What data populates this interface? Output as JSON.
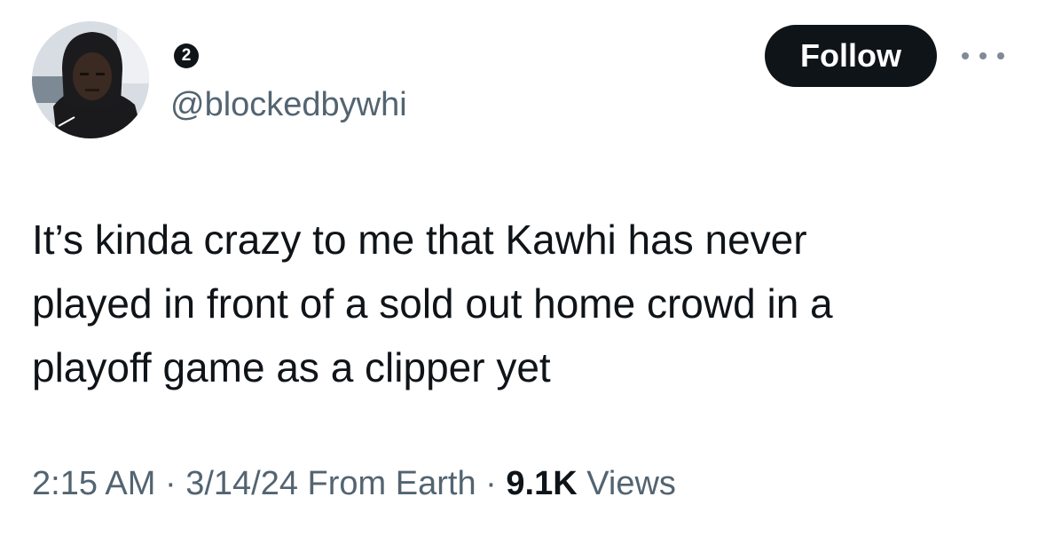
{
  "author": {
    "badge_count": "2",
    "handle": "@blockedbywhi",
    "avatar_icon": "profile-photo-person-in-hood"
  },
  "actions": {
    "follow_label": "Follow",
    "more_icon": "more-horizontal-icon"
  },
  "tweet": {
    "text": "It’s kinda crazy to me that Kawhi has never\nplayed in front of a sold out home crowd in a\nplayoff game as a clipper yet"
  },
  "meta": {
    "time": "2:15 AM",
    "sep1": " · ",
    "date": "3/14/24",
    "location": " From Earth",
    "sep2": " · ",
    "views_count": "9.1K",
    "views_label": " Views"
  },
  "colors": {
    "text_primary": "#0f1419",
    "text_secondary": "#536471",
    "follow_bg": "#0f1419",
    "follow_text": "#ffffff"
  }
}
